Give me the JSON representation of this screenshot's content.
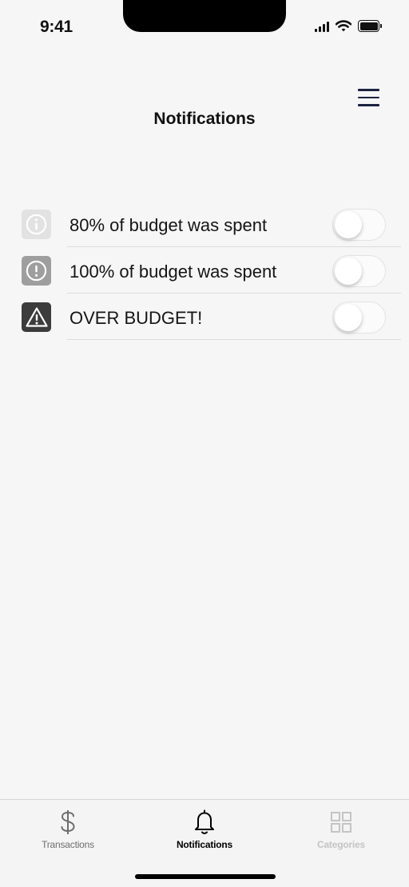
{
  "status_bar": {
    "time": "9:41"
  },
  "header": {
    "title": "Notifications",
    "menu_icon": "hamburger-menu-icon"
  },
  "notifications": [
    {
      "label": "80% of budget was spent",
      "icon": "info-icon",
      "icon_bg": "#e2e2e2",
      "icon_fg": "#ffffff",
      "enabled": false
    },
    {
      "label": "100% of budget was spent",
      "icon": "alert-circle-icon",
      "icon_bg": "#9e9e9e",
      "icon_fg": "#ffffff",
      "enabled": false
    },
    {
      "label": "OVER BUDGET!",
      "icon": "warning-triangle-icon",
      "icon_bg": "#3c3c3c",
      "icon_fg": "#ffffff",
      "enabled": false
    }
  ],
  "tab_bar": {
    "tabs": [
      {
        "label": "Transactions",
        "icon": "dollar-icon",
        "color": "#6e6e6e",
        "active": false
      },
      {
        "label": "Notifications",
        "icon": "bell-icon",
        "color": "#000000",
        "active": true
      },
      {
        "label": "Categories",
        "icon": "grid-icon",
        "color": "#c4c4c4",
        "active": false
      }
    ]
  }
}
